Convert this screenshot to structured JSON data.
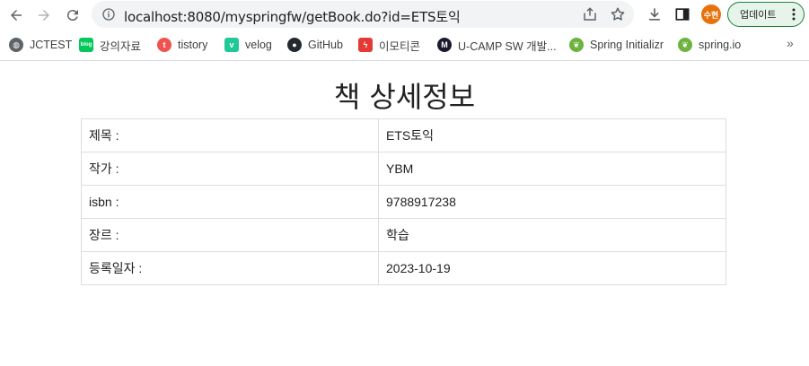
{
  "browser": {
    "url": "localhost:8080/myspringfw/getBook.do?id=ETS토익",
    "avatar_text": "수현",
    "update_label": "업데이트"
  },
  "bookmarks": [
    {
      "label": "JCTEST",
      "icon": "globe-icon",
      "color": "#5f6368"
    },
    {
      "label": "강의자료",
      "icon": "blog-icon",
      "color": "#03c75a"
    },
    {
      "label": "tistory",
      "icon": "tistory-icon",
      "color": "#ef5350"
    },
    {
      "label": "velog",
      "icon": "velog-icon",
      "color": "#20c997"
    },
    {
      "label": "GitHub",
      "icon": "github-icon",
      "color": "#24292f"
    },
    {
      "label": "이모티콘",
      "icon": "emoticon-icon",
      "color": "#e53935"
    },
    {
      "label": "U-CAMP SW 개발...",
      "icon": "ucamp-icon",
      "color": "#1a1a2e"
    },
    {
      "label": "Spring Initializr",
      "icon": "spring-icon",
      "color": "#6db33f"
    },
    {
      "label": "spring.io",
      "icon": "spring-icon",
      "color": "#6db33f"
    }
  ],
  "page": {
    "title": "책 상세정보",
    "rows": [
      {
        "label": "제목 :",
        "value": "ETS토익"
      },
      {
        "label": "작가 :",
        "value": "YBM"
      },
      {
        "label": "isbn :",
        "value": "9788917238"
      },
      {
        "label": "장르 :",
        "value": "학습"
      },
      {
        "label": "등록일자 :",
        "value": "2023-10-19"
      }
    ]
  }
}
